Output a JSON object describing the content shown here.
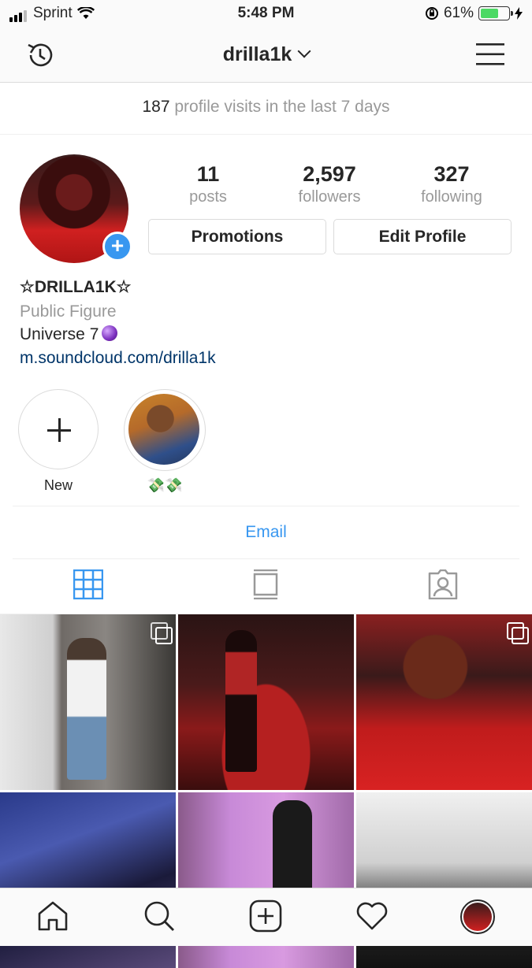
{
  "status": {
    "carrier": "Sprint",
    "time": "5:48 PM",
    "battery": "61%"
  },
  "nav": {
    "username": "drilla1k"
  },
  "visits": {
    "count": "187",
    "text": "profile visits in the last 7 days"
  },
  "stats": [
    {
      "value": "11",
      "label": "posts"
    },
    {
      "value": "2,597",
      "label": "followers"
    },
    {
      "value": "327",
      "label": "following"
    }
  ],
  "buttons": {
    "promotions": "Promotions",
    "edit": "Edit Profile"
  },
  "bio": {
    "name": "☆DRILLA1K☆",
    "category": "Public Figure",
    "text": "Universe 7",
    "link": "m.soundcloud.com/drilla1k"
  },
  "highlights": {
    "new_label": "New",
    "story_label": "💸💸"
  },
  "contact": {
    "email": "Email"
  },
  "icons": {
    "history": "history-icon",
    "menu": "menu-icon",
    "grid": "grid-icon",
    "feed": "feed-icon",
    "tagged": "tagged-icon",
    "home": "home-icon",
    "search": "search-icon",
    "add": "add-icon",
    "heart": "heart-icon"
  },
  "colors": {
    "accent": "#3897f0",
    "link": "#003569"
  }
}
